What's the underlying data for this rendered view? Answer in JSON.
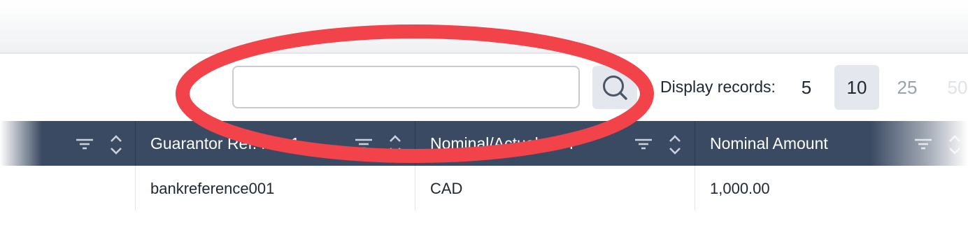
{
  "search": {
    "value": "",
    "placeholder": ""
  },
  "pagination": {
    "label": "Display records:",
    "options": [
      "5",
      "10",
      "25",
      "50"
    ],
    "selected": "10"
  },
  "table": {
    "columns": [
      {
        "label": ""
      },
      {
        "label": "Guarantor Ref. No. 1"
      },
      {
        "label": "Nominal/Actual CCY"
      },
      {
        "label": "Nominal Amount"
      }
    ],
    "rows": [
      [
        "",
        "bankreference001",
        "CAD",
        "1,000.00"
      ]
    ]
  },
  "colors": {
    "header_bg": "#3a4a62",
    "annotation": "#f2434a",
    "selected_bg": "#e4e8ee"
  }
}
